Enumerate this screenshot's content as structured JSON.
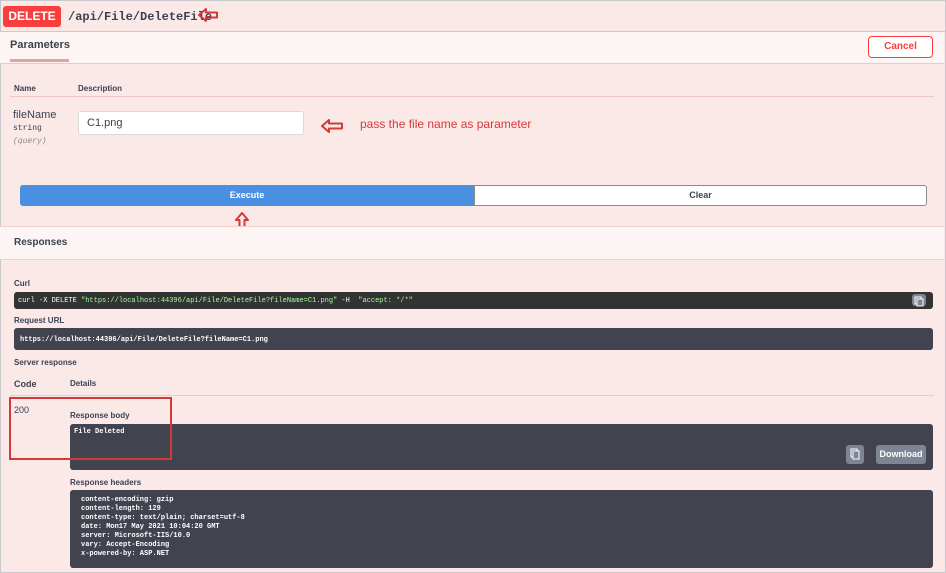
{
  "operation": {
    "method": "DELETE",
    "path": "/api/File/DeleteFile"
  },
  "tabs": {
    "parameters": "Parameters",
    "cancel": "Cancel"
  },
  "param_table": {
    "col_name": "Name",
    "col_description": "Description",
    "param": {
      "name": "fileName",
      "type": "string",
      "in": "(query)",
      "value": "C1.png"
    }
  },
  "annotation": {
    "note": "pass the file name as parameter"
  },
  "buttons": {
    "execute": "Execute",
    "clear": "Clear"
  },
  "responses": {
    "title": "Responses",
    "curl_label": "Curl",
    "curl": {
      "prefix": "curl -X DELETE ",
      "url": "\"https://localhost:44396/api/File/DeleteFile?fileName=C1.png\"",
      "mid": " -H ",
      "accept": " \"accept: */*\""
    },
    "request_url_label": "Request URL",
    "request_url": "https://localhost:44396/api/File/DeleteFile?fileName=C1.png",
    "server_response_label": "Server response",
    "code_header": "Code",
    "details_header": "Details",
    "code": "200",
    "response_body_label": "Response body",
    "response_body": "File Deleted",
    "download": "Download",
    "response_headers_label": "Response headers",
    "headers": [
      "content-encoding: gzip",
      "content-length: 129",
      "content-type: text/plain; charset=utf-8",
      "date: Mon17 May 2021 10:04:20 GMT",
      "server: Microsoft-IIS/10.0",
      "vary: Accept-Encoding",
      "x-powered-by: ASP.NET"
    ]
  },
  "colors": {
    "delete_method": "#f93e3e",
    "execute": "#4990e2",
    "annotation_red": "#d23a3a",
    "code_bg": "#41444e"
  }
}
